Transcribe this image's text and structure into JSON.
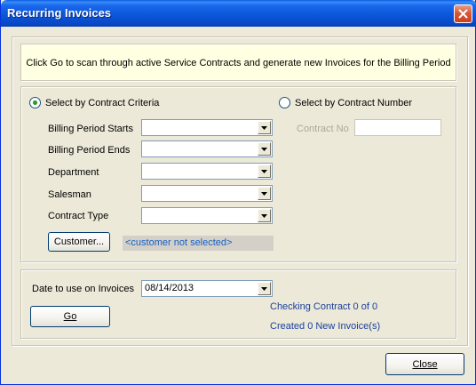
{
  "window": {
    "title": "Recurring Invoices"
  },
  "info": {
    "text": "Click Go to scan through active Service Contracts and generate new Invoices for the Billing Period"
  },
  "criteria": {
    "select_by_criteria_label": "Select by Contract Criteria",
    "select_by_number_label": "Select by Contract Number",
    "selected_mode": "criteria",
    "fields": [
      {
        "label": "Billing Period Starts",
        "value": ""
      },
      {
        "label": "Billing Period Ends",
        "value": ""
      },
      {
        "label": "Department",
        "value": ""
      },
      {
        "label": "Salesman",
        "value": ""
      },
      {
        "label": "Contract Type",
        "value": ""
      }
    ],
    "contract_no_label": "Contract No",
    "contract_no_value": "",
    "customer_button_label": "Customer...",
    "customer_display": "<customer not selected>"
  },
  "run": {
    "date_label": "Date to use on Invoices",
    "date_value": "08/14/2013",
    "go_label": "Go",
    "status_checking": "Checking Contract 0 of 0",
    "status_created": "Created 0 New Invoice(s)"
  },
  "footer": {
    "close_label": "Close"
  },
  "colors": {
    "titlebar": "#0a55d8",
    "info_background": "#ffffe1",
    "status_text": "#1a3fa0",
    "customer_text": "#1560c4"
  }
}
